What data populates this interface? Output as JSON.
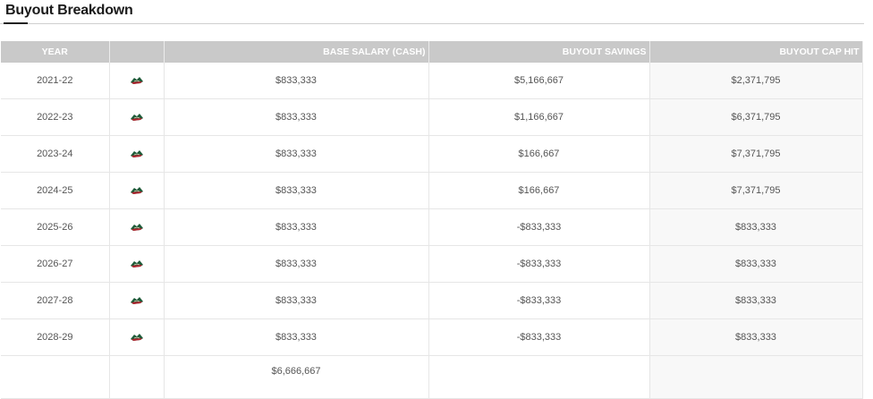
{
  "section": {
    "title": "Buyout Breakdown"
  },
  "table": {
    "headers": {
      "year": "YEAR",
      "logo": "",
      "base_salary": "BASE SALARY (CASH)",
      "savings": "BUYOUT SAVINGS",
      "cap_hit": "BUYOUT CAP HIT"
    },
    "team_icon": "minnesota-wild-logo-icon",
    "rows": [
      {
        "year": "2021-22",
        "base_salary": "$833,333",
        "savings": "$5,166,667",
        "cap_hit": "$2,371,795"
      },
      {
        "year": "2022-23",
        "base_salary": "$833,333",
        "savings": "$1,166,667",
        "cap_hit": "$6,371,795"
      },
      {
        "year": "2023-24",
        "base_salary": "$833,333",
        "savings": "$166,667",
        "cap_hit": "$7,371,795"
      },
      {
        "year": "2024-25",
        "base_salary": "$833,333",
        "savings": "$166,667",
        "cap_hit": "$7,371,795"
      },
      {
        "year": "2025-26",
        "base_salary": "$833,333",
        "savings": "-$833,333",
        "cap_hit": "$833,333"
      },
      {
        "year": "2026-27",
        "base_salary": "$833,333",
        "savings": "-$833,333",
        "cap_hit": "$833,333"
      },
      {
        "year": "2027-28",
        "base_salary": "$833,333",
        "savings": "-$833,333",
        "cap_hit": "$833,333"
      },
      {
        "year": "2028-29",
        "base_salary": "$833,333",
        "savings": "-$833,333",
        "cap_hit": "$833,333"
      }
    ],
    "total": {
      "base_salary": "$6,666,667"
    }
  },
  "colors": {
    "header_bg": "#c9c9c9",
    "logo_green": "#1f5c3a",
    "logo_red": "#b5232f"
  }
}
